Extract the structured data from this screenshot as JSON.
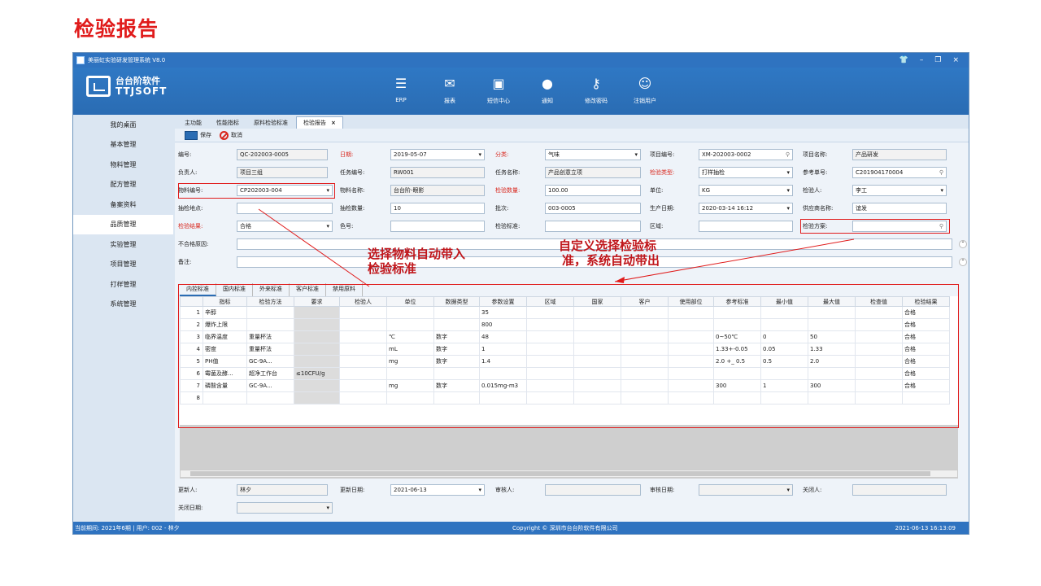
{
  "slide_title": "检验报告",
  "window": {
    "title": "美丽虹实验研发管理系统 V8.0",
    "controls": [
      "👕",
      "–",
      "❐",
      "×"
    ]
  },
  "logo": {
    "line1": "台台阶软件",
    "line2": "TTJSOFT"
  },
  "toolbar": [
    {
      "label": "ERP",
      "icon": "erp-icon"
    },
    {
      "label": "报表",
      "icon": "chart-icon"
    },
    {
      "label": "短信中心",
      "icon": "sms-icon"
    },
    {
      "label": "通知",
      "icon": "notice-icon"
    },
    {
      "label": "修改密码",
      "icon": "key-icon"
    },
    {
      "label": "注销用户",
      "icon": "users-icon"
    }
  ],
  "sidebar": [
    "我的桌面",
    "基本管理",
    "物料管理",
    "配方管理",
    "备案资料",
    "品质管理",
    "实验管理",
    "项目管理",
    "打样管理",
    "系统管理"
  ],
  "tabs": [
    "主功能",
    "性能指标",
    "原料检验标准",
    "检验报告"
  ],
  "actions": {
    "save": "保存",
    "cancel": "取消"
  },
  "form": {
    "code_label": "编号:",
    "code": "QC-202003-0005",
    "date_label": "日期:",
    "date": "2019-05-07",
    "category_label": "分类:",
    "category": "气味",
    "project_no_label": "项目编号:",
    "project_no": "XM-202003-0002",
    "project_name_label": "项目名称:",
    "project_name": "产品研发",
    "owner_label": "负责人:",
    "owner": "项目三组",
    "task_no_label": "任务编号:",
    "task_no": "RW001",
    "task_name_label": "任务名称:",
    "task_name": "产品创意立项",
    "inspect_type_label": "检验类型:",
    "inspect_type": "打样抽检",
    "ref_no_label": "参考单号:",
    "ref_no": "C201904170004",
    "material_no_label": "物料编号:",
    "material_no": "CP202003-004",
    "material_name_label": "物料名称:",
    "material_name": "台台阶-眼影",
    "inspect_qty_label": "检验数量:",
    "inspect_qty": "100.00",
    "unit_label": "单位:",
    "unit": "KG",
    "inspector_label": "检验人:",
    "inspector": "李工",
    "sample_place_label": "抽检地点:",
    "sample_place": "",
    "sample_qty_label": "抽检数量:",
    "sample_qty": "10",
    "batch_label": "批次:",
    "batch": "003-0005",
    "prod_date_label": "生产日期:",
    "prod_date": "2020-03-14 16:12",
    "supplier_label": "供应商名称:",
    "supplier": "谊发",
    "result_label": "检验结果:",
    "result": "合格",
    "color_label": "色号:",
    "color": "",
    "standard_label": "检验标准:",
    "standard": "",
    "region_label": "区域:",
    "region": "",
    "plan_label": "检验方案:",
    "plan": "",
    "reject_label": "不合格原因:",
    "reject": "",
    "remark_label": "备注:",
    "remark": ""
  },
  "annotations": {
    "left": [
      "选择物料自动带入",
      "检验标准"
    ],
    "right": [
      "自定义选择检验标",
      "准，系统自动带出"
    ]
  },
  "subtabs": [
    "内控标准",
    "国内标准",
    "外来标准",
    "客户标准",
    "禁用原料"
  ],
  "grid": {
    "columns": [
      "",
      "指标",
      "检验方法",
      "要求",
      "检验人",
      "单位",
      "数据类型",
      "参数设置",
      "区域",
      "国家",
      "客户",
      "使用部位",
      "参考标准",
      "最小值",
      "最大值",
      "检查值",
      "检验结果"
    ],
    "rows": [
      [
        "1",
        "辛醇",
        "",
        "",
        "",
        "",
        "",
        "35",
        "",
        "",
        "",
        "",
        "",
        "",
        "",
        "",
        "合格"
      ],
      [
        "2",
        "爆炸上限",
        "",
        "",
        "",
        "",
        "",
        "800",
        "",
        "",
        "",
        "",
        "",
        "",
        "",
        "",
        "合格"
      ],
      [
        "3",
        "临界温度",
        "重量杯法",
        "",
        "",
        "℃",
        "数字",
        "48",
        "",
        "",
        "",
        "",
        "0~50℃",
        "0",
        "50",
        "",
        "合格"
      ],
      [
        "4",
        "密度",
        "重量杯法",
        "",
        "",
        "mL",
        "数字",
        "1",
        "",
        "",
        "",
        "",
        "1.33+-0.05",
        "0.05",
        "1.33",
        "",
        "合格"
      ],
      [
        "5",
        "PH值",
        "GC-9A...",
        "",
        "",
        "mg",
        "数字",
        "1.4",
        "",
        "",
        "",
        "",
        "2.0 +_ 0.5",
        "0.5",
        "2.0",
        "",
        "合格"
      ],
      [
        "6",
        "霉菌及酵...",
        "超净工作台",
        "≤10CFU/g",
        "",
        "",
        "",
        "",
        "",
        "",
        "",
        "",
        "",
        "",
        "",
        "",
        "合格"
      ],
      [
        "7",
        "磷酸含量",
        "GC-9A...",
        "",
        "",
        "mg",
        "数字",
        "0.015mg-m3",
        "",
        "",
        "",
        "",
        "300",
        "1",
        "300",
        "",
        "合格"
      ],
      [
        "8",
        "",
        "",
        "",
        "",
        "",
        "",
        "",
        "",
        "",
        "",
        "",
        "",
        "",
        "",
        "",
        ""
      ]
    ]
  },
  "footer_form": {
    "updater_label": "更新人:",
    "updater": "林夕",
    "update_date_label": "更新日期:",
    "update_date": "2021-06-13",
    "reviewer_label": "审核人:",
    "reviewer": "",
    "review_date_label": "审核日期:",
    "review_date": "",
    "closer_label": "关闭人:",
    "closer": "",
    "close_date_label": "关闭日期:",
    "close_date": ""
  },
  "status": {
    "period": "当前期间:  2021年6期  |  用户:  002 - 林夕",
    "copyright": "Copyright © 深圳市台台阶软件有限公司",
    "time": "2021-06-13 16:13:09"
  }
}
